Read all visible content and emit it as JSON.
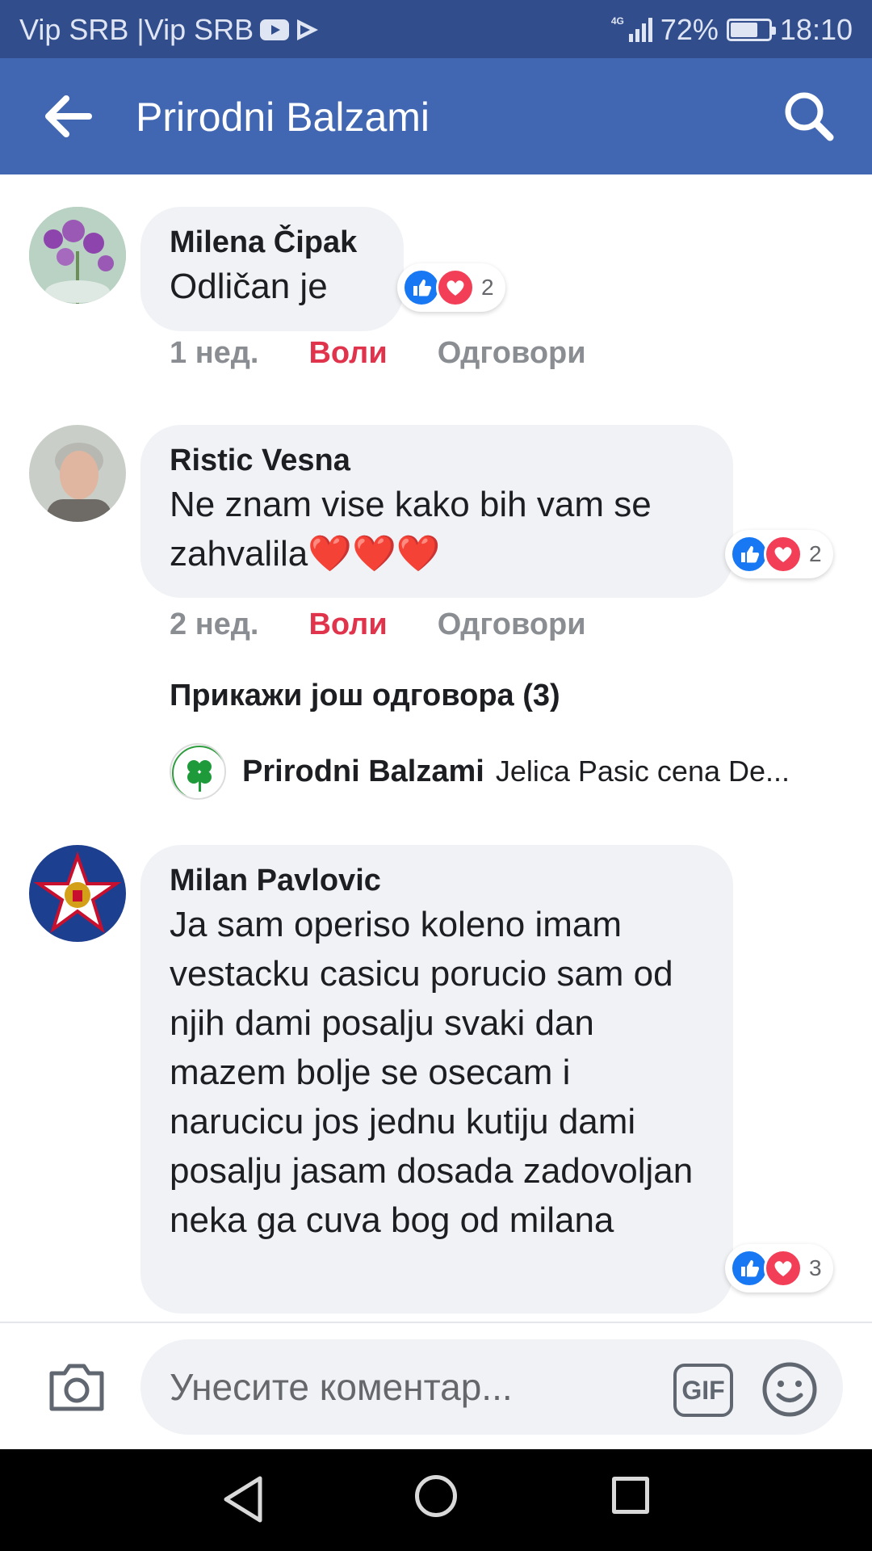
{
  "status_bar": {
    "carrier": "Vip SRB |Vip SRB",
    "network_label": "4G",
    "battery": "72%",
    "battery_level": 0.72,
    "time": "18:10"
  },
  "header": {
    "title": "Prirodni Balzami",
    "back_icon": "arrow-left-icon",
    "search_icon": "search-icon",
    "color": "#4267b2"
  },
  "comments": [
    {
      "author": "Milena Čipak",
      "text": "Odličan je",
      "reaction_count": "2",
      "time": "1 нед.",
      "like_label": "Воли",
      "reply_label": "Одговори"
    },
    {
      "author": "Ristic Vesna",
      "text": "Ne znam vise kako bih vam se zahvalila❤️❤️❤️",
      "reaction_count": "2",
      "time": "2 нед.",
      "like_label": "Воли",
      "reply_label": "Одговори",
      "more_replies": "Прикажи још одговора (3)",
      "reply_preview": {
        "author": "Prirodni Balzami",
        "text": "Jelica Pasic cena De..."
      }
    },
    {
      "author": "Milan Pavlovic",
      "text": "Ja sam operiso koleno imam vestacku casicu porucio sam od njih dami posalju svaki dan mazem bolje se osecam i narucicu jos jednu kutiju dami posalju jasam dosada zadovoljan neka ga cuva bog od milana",
      "reaction_count": "3"
    }
  ],
  "composer": {
    "placeholder": "Унесите коментар...",
    "gif_label": "GIF"
  },
  "colors": {
    "accent": "#4267b2",
    "status_bar": "#324d8c",
    "like_link": "#e0344d",
    "bubble": "#f0f2f5"
  }
}
